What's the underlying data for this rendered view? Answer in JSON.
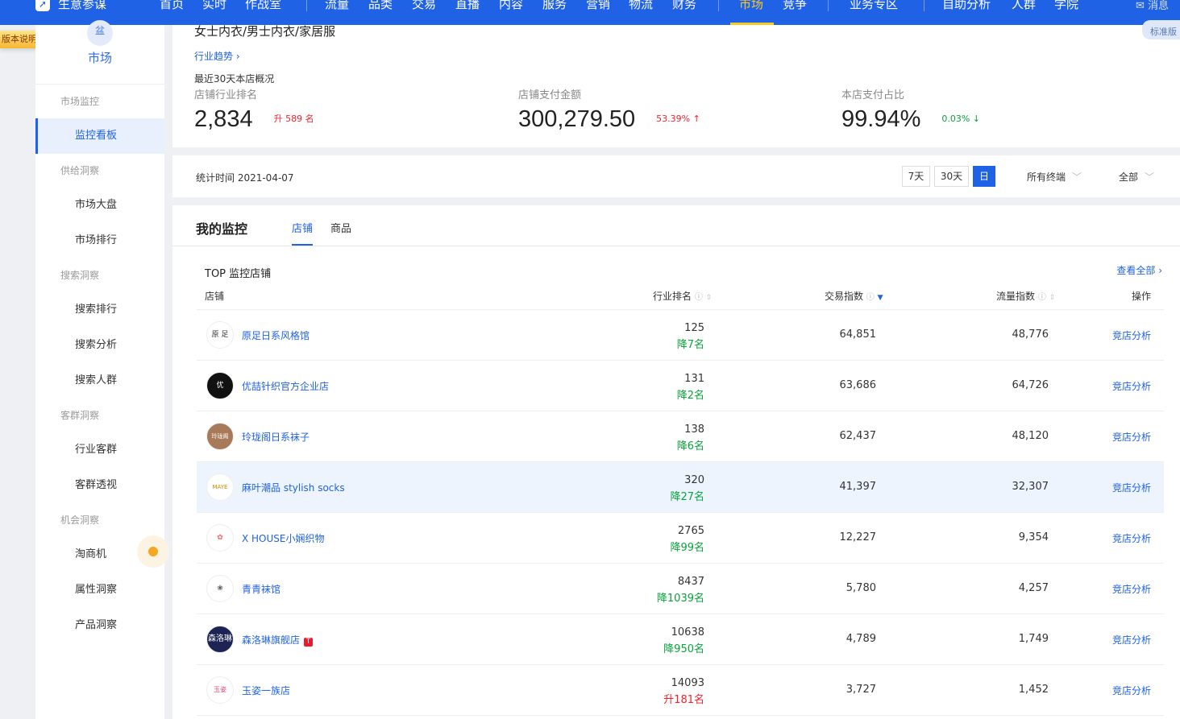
{
  "topnav": {
    "brand": "生意参谋",
    "items": [
      "首页",
      "实时",
      "作战室",
      "流量",
      "品类",
      "交易",
      "直播",
      "内容",
      "服务",
      "营销",
      "物流",
      "财务",
      "市场",
      "竞争",
      "业务专区",
      "自助分析",
      "人群",
      "学院"
    ],
    "active": "市场",
    "message": "消息"
  },
  "version_badge": "版本说明",
  "edition": "标准版",
  "sidebar": {
    "module": "市场",
    "module_icon": "盆",
    "groups": [
      {
        "label": "市场监控",
        "items": [
          "监控看板"
        ]
      },
      {
        "label": "供给洞察",
        "items": [
          "市场大盘",
          "市场排行"
        ]
      },
      {
        "label": "搜索洞察",
        "items": [
          "搜索排行",
          "搜索分析",
          "搜索人群"
        ]
      },
      {
        "label": "客群洞察",
        "items": [
          "行业客群",
          "客群透视"
        ]
      },
      {
        "label": "机会洞察",
        "items": [
          "淘商机",
          "属性洞察",
          "产品洞察"
        ]
      }
    ],
    "active": "监控看板"
  },
  "overview": {
    "category": "女士内衣/男士内衣/家居服",
    "trend_link": "行业趋势",
    "subtitle": "最近30天本店概况",
    "kpis": [
      {
        "label": "店铺行业排名",
        "value": "2,834",
        "change": "升 589 名",
        "dir": "up"
      },
      {
        "label": "店铺支付金额",
        "value": "300,279.50",
        "change": "53.39% ↑",
        "dir": "up"
      },
      {
        "label": "本店支付占比",
        "value": "99.94%",
        "change": "0.03% ↓",
        "dir": "down"
      }
    ]
  },
  "filters": {
    "stat_time": "统计时间 2021-04-07",
    "periods": [
      "7天",
      "30天",
      "日"
    ],
    "active_period": "日",
    "terminal": "所有终端",
    "scope": "全部"
  },
  "monitor": {
    "title": "我的监控",
    "tabs": [
      "店铺",
      "商品"
    ],
    "active_tab": "店铺",
    "section": "TOP 监控店铺",
    "view_all": "查看全部",
    "columns": [
      "店铺",
      "行业排名",
      "交易指数",
      "流量指数",
      "操作"
    ],
    "rows": [
      {
        "name": "原足日系风格馆",
        "logo": "原 足",
        "rank": "125",
        "rank_change": "降7名",
        "dir": "down",
        "trade": "64,851",
        "traffic": "48,776",
        "action": "竞店分析"
      },
      {
        "name": "优喆针织官方企业店",
        "logo": "优",
        "rank": "131",
        "rank_change": "降2名",
        "dir": "down",
        "trade": "63,686",
        "traffic": "64,726",
        "action": "竞店分析"
      },
      {
        "name": "玲珑阁日系袜子",
        "logo": "玲珑阁",
        "rank": "138",
        "rank_change": "降6名",
        "dir": "down",
        "trade": "62,437",
        "traffic": "48,120",
        "action": "竞店分析"
      },
      {
        "name": "麻叶潮品 stylish socks",
        "logo": "MAYE",
        "rank": "320",
        "rank_change": "降27名",
        "dir": "down",
        "trade": "41,397",
        "traffic": "32,307",
        "action": "竞店分析"
      },
      {
        "name": "X HOUSE小娴织物",
        "logo": "✿",
        "rank": "2765",
        "rank_change": "降99名",
        "dir": "down",
        "trade": "12,227",
        "traffic": "9,354",
        "action": "竞店分析"
      },
      {
        "name": "青青袜馆",
        "logo": "❀",
        "rank": "8437",
        "rank_change": "降1039名",
        "dir": "down",
        "trade": "5,780",
        "traffic": "4,257",
        "action": "竞店分析"
      },
      {
        "name": "森洛琳旗舰店",
        "logo": "森洛琳",
        "tmall": "T",
        "rank": "10638",
        "rank_change": "降950名",
        "dir": "down",
        "trade": "4,789",
        "traffic": "1,749",
        "action": "竞店分析"
      },
      {
        "name": "玉姿一族店",
        "logo": "玉姿",
        "rank": "14093",
        "rank_change": "升181名",
        "dir": "up",
        "trade": "3,727",
        "traffic": "1,452",
        "action": "竞店分析"
      }
    ]
  },
  "colors": {
    "brand": "#2062e5",
    "accent": "#f7c92a",
    "up": "#f5222d",
    "down": "#09a33b"
  }
}
